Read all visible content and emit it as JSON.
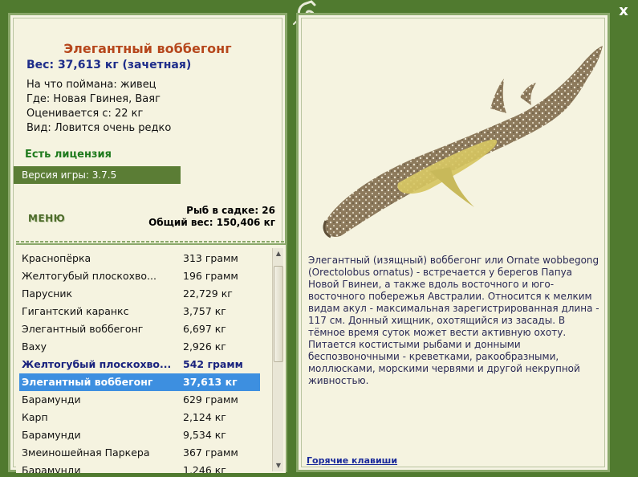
{
  "fish": {
    "title": "Элегантный воббегонг",
    "weight": "Вес: 37,613 кг (зачетная)",
    "info": [
      "На что поймана: живец",
      "Где: Новая Гвинея, Ваяг",
      "Оценивается с: 22 кг",
      "Вид: Ловится очень редко"
    ],
    "license": "Есть лицензия",
    "version": "Версия игры: 3.7.5"
  },
  "menu": {
    "label": "МЕНЮ"
  },
  "stats": {
    "fish_count": "Рыб в садке: 26",
    "total_weight": "Общий вес: 150,406 кг"
  },
  "list": [
    {
      "name": "Краснопёрка",
      "weight": "313 грамм",
      "state": "normal"
    },
    {
      "name": "Желтогубый плоскохво...",
      "weight": "196 грамм",
      "state": "normal"
    },
    {
      "name": "Парусник",
      "weight": "22,729 кг",
      "state": "normal"
    },
    {
      "name": "Гигантский каранкс",
      "weight": "3,757 кг",
      "state": "normal"
    },
    {
      "name": "Элегантный воббегонг",
      "weight": "6,697 кг",
      "state": "normal"
    },
    {
      "name": "Ваху",
      "weight": "2,926 кг",
      "state": "normal"
    },
    {
      "name": "Желтогубый плоскохво...",
      "weight": "542 грамм",
      "state": "bold"
    },
    {
      "name": "Элегантный воббегонг",
      "weight": "37,613 кг",
      "state": "selected"
    },
    {
      "name": "Барамунди",
      "weight": "629 грамм",
      "state": "normal"
    },
    {
      "name": "Карп",
      "weight": "2,124 кг",
      "state": "normal"
    },
    {
      "name": "Барамунди",
      "weight": "9,534 кг",
      "state": "normal"
    },
    {
      "name": "Змеиношейная Паркера",
      "weight": "367 грамм",
      "state": "normal"
    },
    {
      "name": "Барамунди",
      "weight": "1,246 кг",
      "state": "normal"
    }
  ],
  "description": "Элегантный (изящный) воббегонг или Ornate wobbegong (Orectolobus ornatus) - встречается у берегов Папуа Новой Гвинеи, а также вдоль восточного и юго-восточного побережья Австралии. Относится к мелким видам акул - максимальная зарегистрированная длина - 117 см. Донный хищник, охотящийся из засады. В тёмное время суток может вести активную охоту. Питается костистыми рыбами и донными беспозвоночными - креветками, ракообразными, моллюсками, морскими червями и другой некрупной живностью.",
  "hotkeys": "Горячие клавиши",
  "close": "x",
  "colors": {
    "frame": "#507a2f",
    "selected": "#3d8fe0",
    "title": "#b6471c",
    "weight": "#1e2d8a",
    "license": "#1f7a1d"
  },
  "icons": {
    "decoration": "lizard-icon",
    "close": "close-icon"
  }
}
